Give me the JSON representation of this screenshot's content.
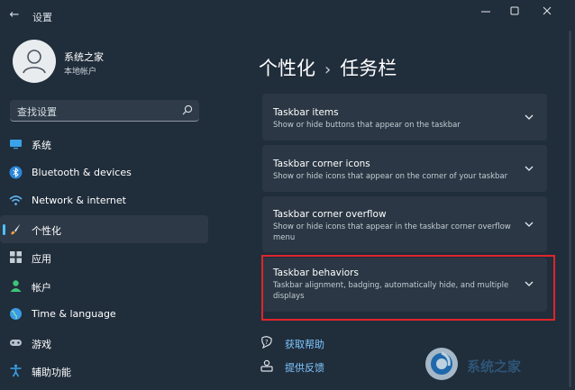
{
  "window": {
    "title": "设置",
    "back_glyph": "←"
  },
  "profile": {
    "name": "系统之家",
    "subtitle": "本地帐户"
  },
  "search": {
    "placeholder": "查找设置"
  },
  "sidebar": {
    "items": [
      {
        "label": "系统",
        "icon": "system-icon",
        "active": false
      },
      {
        "label": "Bluetooth & devices",
        "icon": "bluetooth-icon",
        "active": false
      },
      {
        "label": "Network & internet",
        "icon": "wifi-icon",
        "active": false
      },
      {
        "label": "个性化",
        "icon": "brush-icon",
        "active": true
      },
      {
        "label": "应用",
        "icon": "apps-icon",
        "active": false
      },
      {
        "label": "帐户",
        "icon": "account-icon",
        "active": false
      },
      {
        "label": "Time & language",
        "icon": "globe-icon",
        "active": false
      },
      {
        "label": "游戏",
        "icon": "gamepad-icon",
        "active": false
      },
      {
        "label": "辅助功能",
        "icon": "accessibility-icon",
        "active": false
      }
    ]
  },
  "breadcrumb": {
    "parent": "个性化",
    "separator": "›",
    "current": "任务栏"
  },
  "cards": [
    {
      "title": "Taskbar items",
      "desc": "Show or hide buttons that appear on the taskbar"
    },
    {
      "title": "Taskbar corner icons",
      "desc": "Show or hide icons that appear on the corner of your taskbar"
    },
    {
      "title": "Taskbar corner overflow",
      "desc": "Show or hide icons that appear in the taskbar corner overflow menu"
    },
    {
      "title": "Taskbar behaviors",
      "desc": "Taskbar alignment, badging, automatically hide, and multiple displays"
    }
  ],
  "help": {
    "get_help": "获取帮助",
    "feedback": "提供反馈"
  },
  "watermark": {
    "text": "系统之家"
  },
  "colors": {
    "background": "#202d3b",
    "card": "#2b3744",
    "accent": "#4cc2ff",
    "link": "#7fc7ff",
    "highlight": "#e0242b"
  }
}
